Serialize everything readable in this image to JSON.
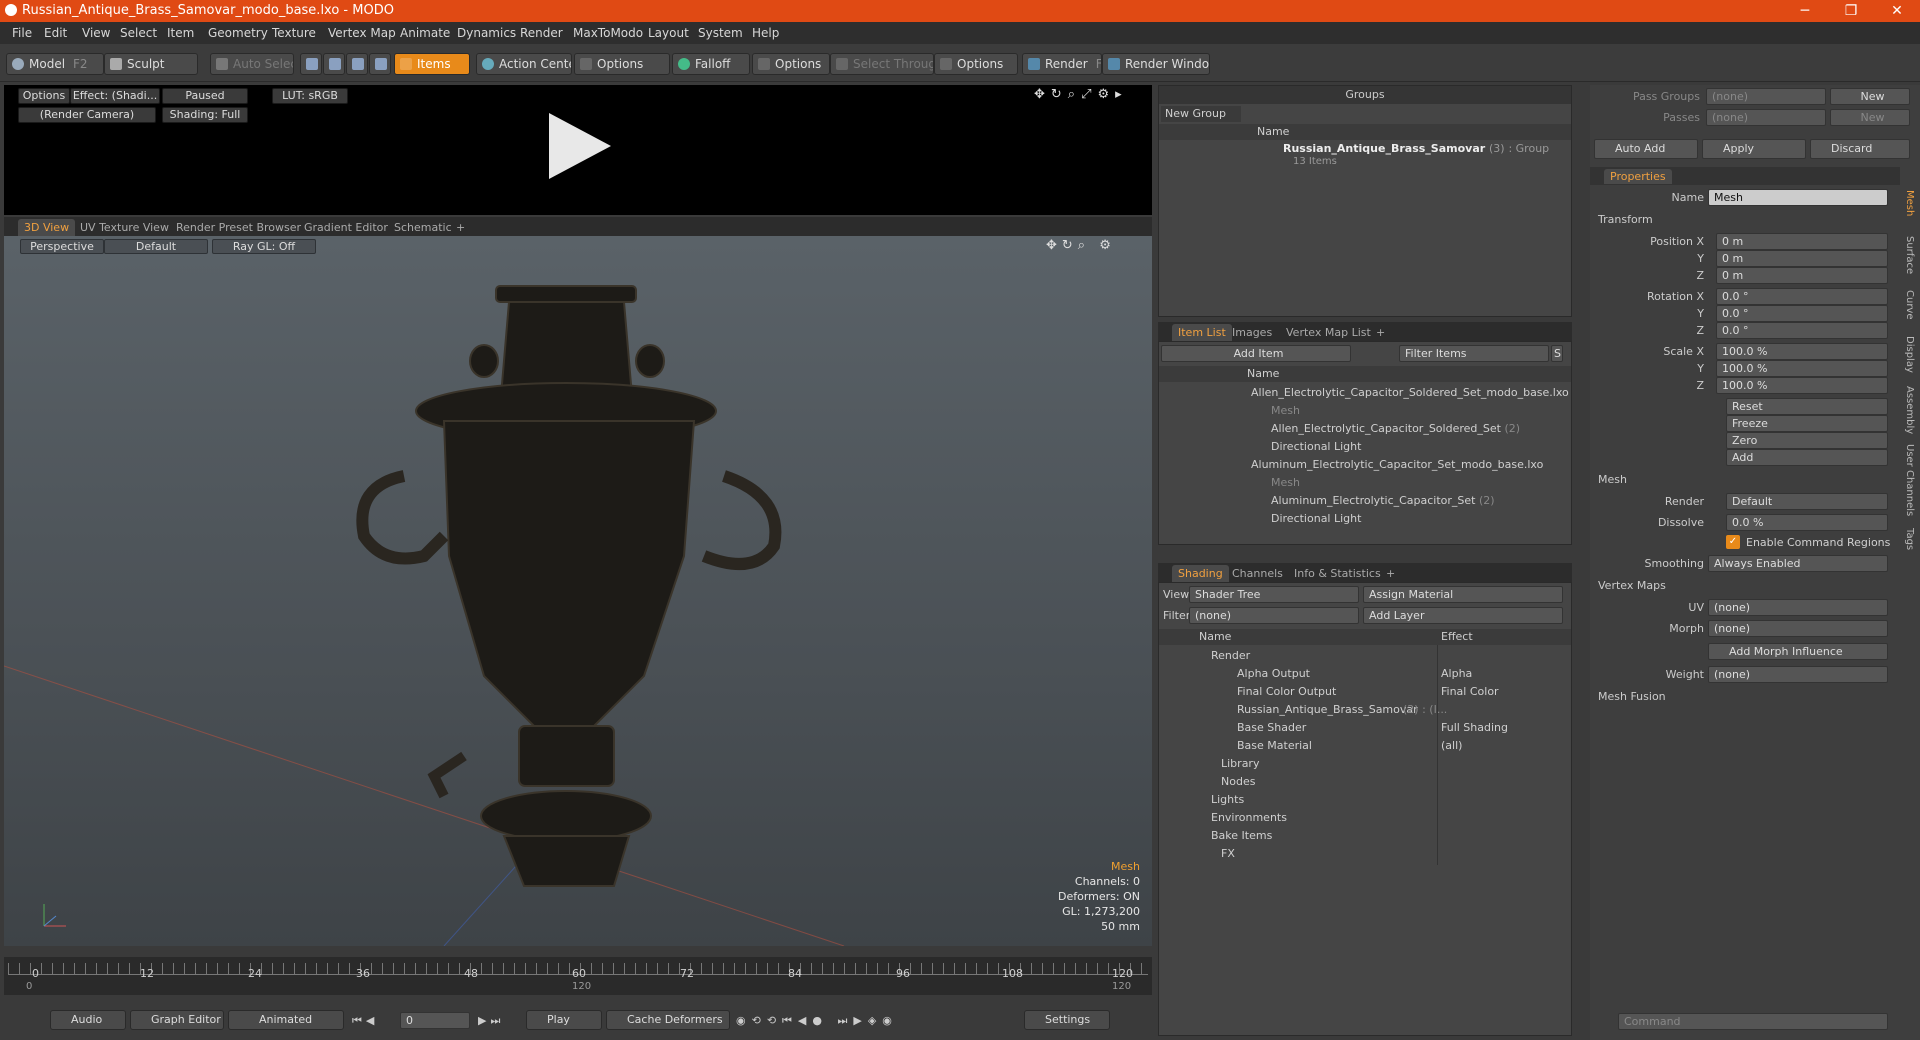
{
  "window": {
    "title": "Russian_Antique_Brass_Samovar_modo_base.lxo - MODO",
    "minimize": "─",
    "maximize": "❐",
    "close": "✕"
  },
  "menu": [
    "File",
    "Edit",
    "View",
    "Select",
    "Item",
    "Geometry",
    "Texture",
    "Vertex Map",
    "Animate",
    "Dynamics",
    "Render",
    "MaxToModo",
    "Layout",
    "System",
    "Help"
  ],
  "toolbar": {
    "model": "Model",
    "model_key": "F2",
    "sculpt": "Sculpt",
    "auto_select": "Auto Select",
    "items": "Items",
    "action_center": "Action Center",
    "options1": "Options",
    "falloff": "Falloff",
    "options2": "Options",
    "select_through": "Select Through",
    "options3": "Options",
    "render": "Render",
    "render_key": "F9",
    "render_window": "Render Window"
  },
  "preview": {
    "options": "Options",
    "effect": "Effect: (Shadi...",
    "paused": "Paused",
    "lut": "LUT: sRGB",
    "camera": "(Render Camera)",
    "shading": "Shading: Full"
  },
  "viewport_tabs": [
    "3D View",
    "UV Texture View",
    "Render Preset Browser",
    "Gradient Editor",
    "Schematic",
    "+"
  ],
  "viewport": {
    "perspective": "Perspective",
    "default": "Default",
    "raygl": "Ray GL: Off",
    "info": {
      "title": "Mesh",
      "channels": "Channels: 0",
      "deformers": "Deformers: ON",
      "gl": "GL: 1,273,200",
      "mm": "50 mm"
    }
  },
  "timeline": {
    "ticks": [
      "0",
      "12",
      "24",
      "36",
      "48",
      "60",
      "72",
      "84",
      "96",
      "108",
      "120"
    ],
    "start": "0",
    "mid": "120",
    "end": "120"
  },
  "bottombar": {
    "audio": "Audio",
    "graph_editor": "Graph Editor",
    "animated": "Animated",
    "frame": "0",
    "play": "Play",
    "cache": "Cache Deformers",
    "settings": "Settings"
  },
  "groups": {
    "title": "Groups",
    "new_group": "New Group",
    "col_name": "Name",
    "item_name": "Russian_Antique_Brass_Samovar",
    "item_count": "(3)",
    "item_type": ": Group",
    "item_sub": "13 Items"
  },
  "item_list": {
    "tabs": [
      "Item List",
      "Images",
      "Vertex Map List",
      "+"
    ],
    "add_item": "Add Item",
    "filter_items": "Filter Items",
    "s": "S",
    "f": "F",
    "col_name": "Name",
    "rows": [
      {
        "label": "Allen_Electrolytic_Capacitor_Soldered_Set_modo_base.lxo",
        "extra": ""
      },
      {
        "label": "Mesh",
        "extra": ""
      },
      {
        "label": "Allen_Electrolytic_Capacitor_Soldered_Set",
        "extra": "(2)"
      },
      {
        "label": "Directional Light",
        "extra": ""
      },
      {
        "label": "Aluminum_Electrolytic_Capacitor_Set_modo_base.lxo",
        "extra": ""
      },
      {
        "label": "Mesh",
        "extra": ""
      },
      {
        "label": "Aluminum_Electrolytic_Capacitor_Set",
        "extra": "(2)"
      },
      {
        "label": "Directional Light",
        "extra": ""
      }
    ]
  },
  "shading": {
    "tabs": [
      "Shading",
      "Channels",
      "Info & Statistics",
      "+"
    ],
    "view_label": "View",
    "view": "Shader Tree",
    "assign": "Assign Material",
    "f": "F",
    "filter_label": "Filter",
    "filter": "(none)",
    "add_layer": "Add Layer",
    "s": "S",
    "col_name": "Name",
    "col_effect": "Effect",
    "rows": [
      {
        "label": "Render",
        "effect": ""
      },
      {
        "label": "Alpha Output",
        "effect": "Alpha"
      },
      {
        "label": "Final Color Output",
        "effect": "Final Color"
      },
      {
        "label": "Russian_Antique_Brass_Samovar",
        "extra": "(2) : (I...",
        "effect": ""
      },
      {
        "label": "Base Shader",
        "effect": "Full Shading"
      },
      {
        "label": "Base Material",
        "effect": "(all)"
      },
      {
        "label": "Library",
        "effect": ""
      },
      {
        "label": "Nodes",
        "effect": ""
      },
      {
        "label": "Lights",
        "effect": ""
      },
      {
        "label": "Environments",
        "effect": ""
      },
      {
        "label": "Bake Items",
        "effect": ""
      },
      {
        "label": "FX",
        "effect": ""
      }
    ]
  },
  "right": {
    "pass_groups": "Pass Groups",
    "passes": "Passes",
    "none": "(none)",
    "new": "New",
    "auto_add": "Auto Add",
    "apply": "Apply",
    "discard": "Discard",
    "properties": "Properties",
    "name_label": "Name",
    "name": "Mesh",
    "transform": "Transform",
    "position_x": "Position X",
    "y": "Y",
    "z": "Z",
    "pos": [
      "0 m",
      "0 m",
      "0 m"
    ],
    "rotation_x": "Rotation X",
    "rot": [
      "0.0 °",
      "0.0 °",
      "0.0 °"
    ],
    "scale_x": "Scale X",
    "scl": [
      "100.0 %",
      "100.0 %",
      "100.0 %"
    ],
    "reset": "Reset",
    "freeze": "Freeze",
    "zero": "Zero",
    "add": "Add",
    "mesh": "Mesh",
    "render_label": "Render",
    "render": "Default",
    "dissolve_label": "Dissolve",
    "dissolve": "0.0 %",
    "enable_cmd": "Enable Command Regions",
    "smoothing_label": "Smoothing",
    "smoothing": "Always Enabled",
    "vertex_maps": "Vertex Maps",
    "uv_label": "UV",
    "uv": "(none)",
    "morph_label": "Morph",
    "morph": "(none)",
    "add_morph": "Add Morph Influence",
    "weight_label": "Weight",
    "weight": "(none)",
    "mesh_fusion": "Mesh Fusion",
    "vtabs": [
      "Mesh",
      "Surface",
      "Curve",
      "Display",
      "Assembly",
      "User Channels",
      "Tags"
    ],
    "command": "Command"
  }
}
